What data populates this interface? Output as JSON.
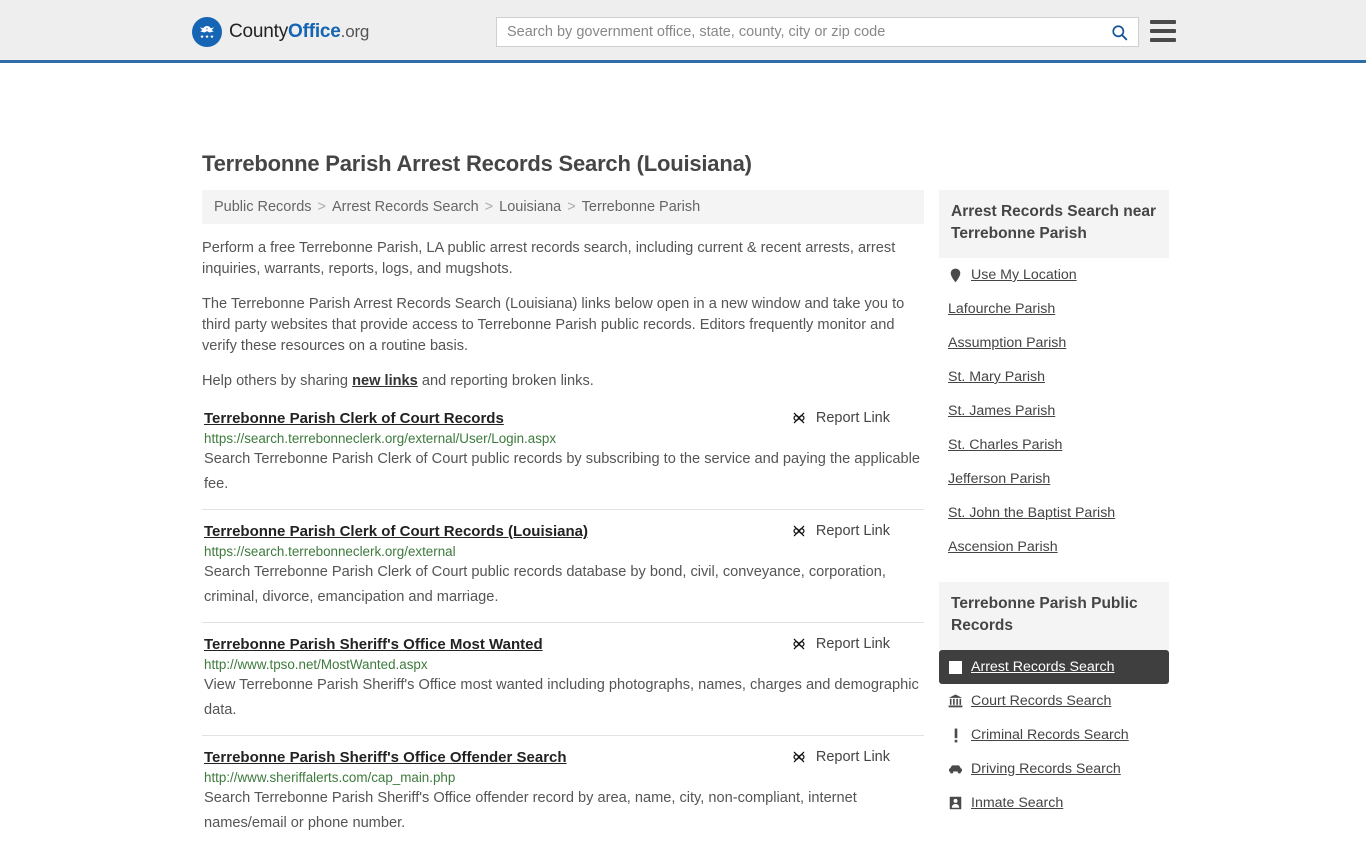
{
  "header": {
    "logo": {
      "part1": "County",
      "part2": "Office",
      "part3": ".org",
      "icon": "eagle-seal-icon"
    },
    "search": {
      "placeholder": "Search by government office, state, county, city or zip code",
      "value": ""
    },
    "search_icon": "search-icon",
    "menu_icon": "hamburger-menu-icon"
  },
  "page_title": "Terrebonne Parish Arrest Records Search (Louisiana)",
  "breadcrumb": [
    "Public Records",
    "Arrest Records Search",
    "Louisiana",
    "Terrebonne Parish"
  ],
  "breadcrumb_separator": ">",
  "intro": {
    "p1": "Perform a free Terrebonne Parish, LA public arrest records search, including current & recent arrests, arrest inquiries, warrants, reports, logs, and mugshots.",
    "p2": "The Terrebonne Parish Arrest Records Search (Louisiana) links below open in a new window and take you to third party websites that provide access to Terrebonne Parish public records. Editors frequently monitor and verify these resources on a routine basis.",
    "p3_before": "Help others by sharing ",
    "p3_link": "new links",
    "p3_after": " and reporting broken links."
  },
  "report_link_label": "Report Link",
  "report_link_icon": "broken-link-icon",
  "results": [
    {
      "title": "Terrebonne Parish Clerk of Court Records",
      "url": "https://search.terrebonneclerk.org/external/User/Login.aspx",
      "description": "Search Terrebonne Parish Clerk of Court public records by subscribing to the service and paying the applicable fee."
    },
    {
      "title": "Terrebonne Parish Clerk of Court Records (Louisiana)",
      "url": "https://search.terrebonneclerk.org/external",
      "description": "Search Terrebonne Parish Clerk of Court public records database by bond, civil, conveyance, corporation, criminal, divorce, emancipation and marriage."
    },
    {
      "title": "Terrebonne Parish Sheriff's Office Most Wanted",
      "url": "http://www.tpso.net/MostWanted.aspx",
      "description": "View Terrebonne Parish Sheriff's Office most wanted including photographs, names, charges and demographic data."
    },
    {
      "title": "Terrebonne Parish Sheriff's Office Offender Search",
      "url": "http://www.sheriffalerts.com/cap_main.php",
      "description": "Search Terrebonne Parish Sheriff's Office offender record by area, name, city, non-compliant, internet names/email or phone number."
    }
  ],
  "sidebar": {
    "nearby": {
      "heading": "Arrest Records Search near Terrebonne Parish",
      "items": [
        {
          "label": "Use My Location",
          "icon": "map-pin-icon"
        },
        {
          "label": "Lafourche Parish",
          "icon": ""
        },
        {
          "label": "Assumption Parish",
          "icon": ""
        },
        {
          "label": "St. Mary Parish",
          "icon": ""
        },
        {
          "label": "St. James Parish",
          "icon": ""
        },
        {
          "label": "St. Charles Parish",
          "icon": ""
        },
        {
          "label": "Jefferson Parish",
          "icon": ""
        },
        {
          "label": "St. John the Baptist Parish",
          "icon": ""
        },
        {
          "label": "Ascension Parish",
          "icon": ""
        }
      ]
    },
    "public_records": {
      "heading": "Terrebonne Parish Public Records",
      "items": [
        {
          "label": "Arrest Records Search",
          "icon": "square-icon",
          "active": true
        },
        {
          "label": "Court Records Search",
          "icon": "courthouse-icon",
          "active": false
        },
        {
          "label": "Criminal Records Search",
          "icon": "exclamation-icon",
          "active": false
        },
        {
          "label": "Driving Records Search",
          "icon": "car-icon",
          "active": false
        },
        {
          "label": "Inmate Search",
          "icon": "inmate-icon",
          "active": false
        }
      ]
    }
  },
  "colors": {
    "brand_blue": "#1565b4",
    "header_bg": "#eeeeee",
    "header_border": "#2f6ca8",
    "panel_bg": "#f4f4f4",
    "active_bg": "#3f3f3f",
    "url_green": "#3d7a3d"
  }
}
